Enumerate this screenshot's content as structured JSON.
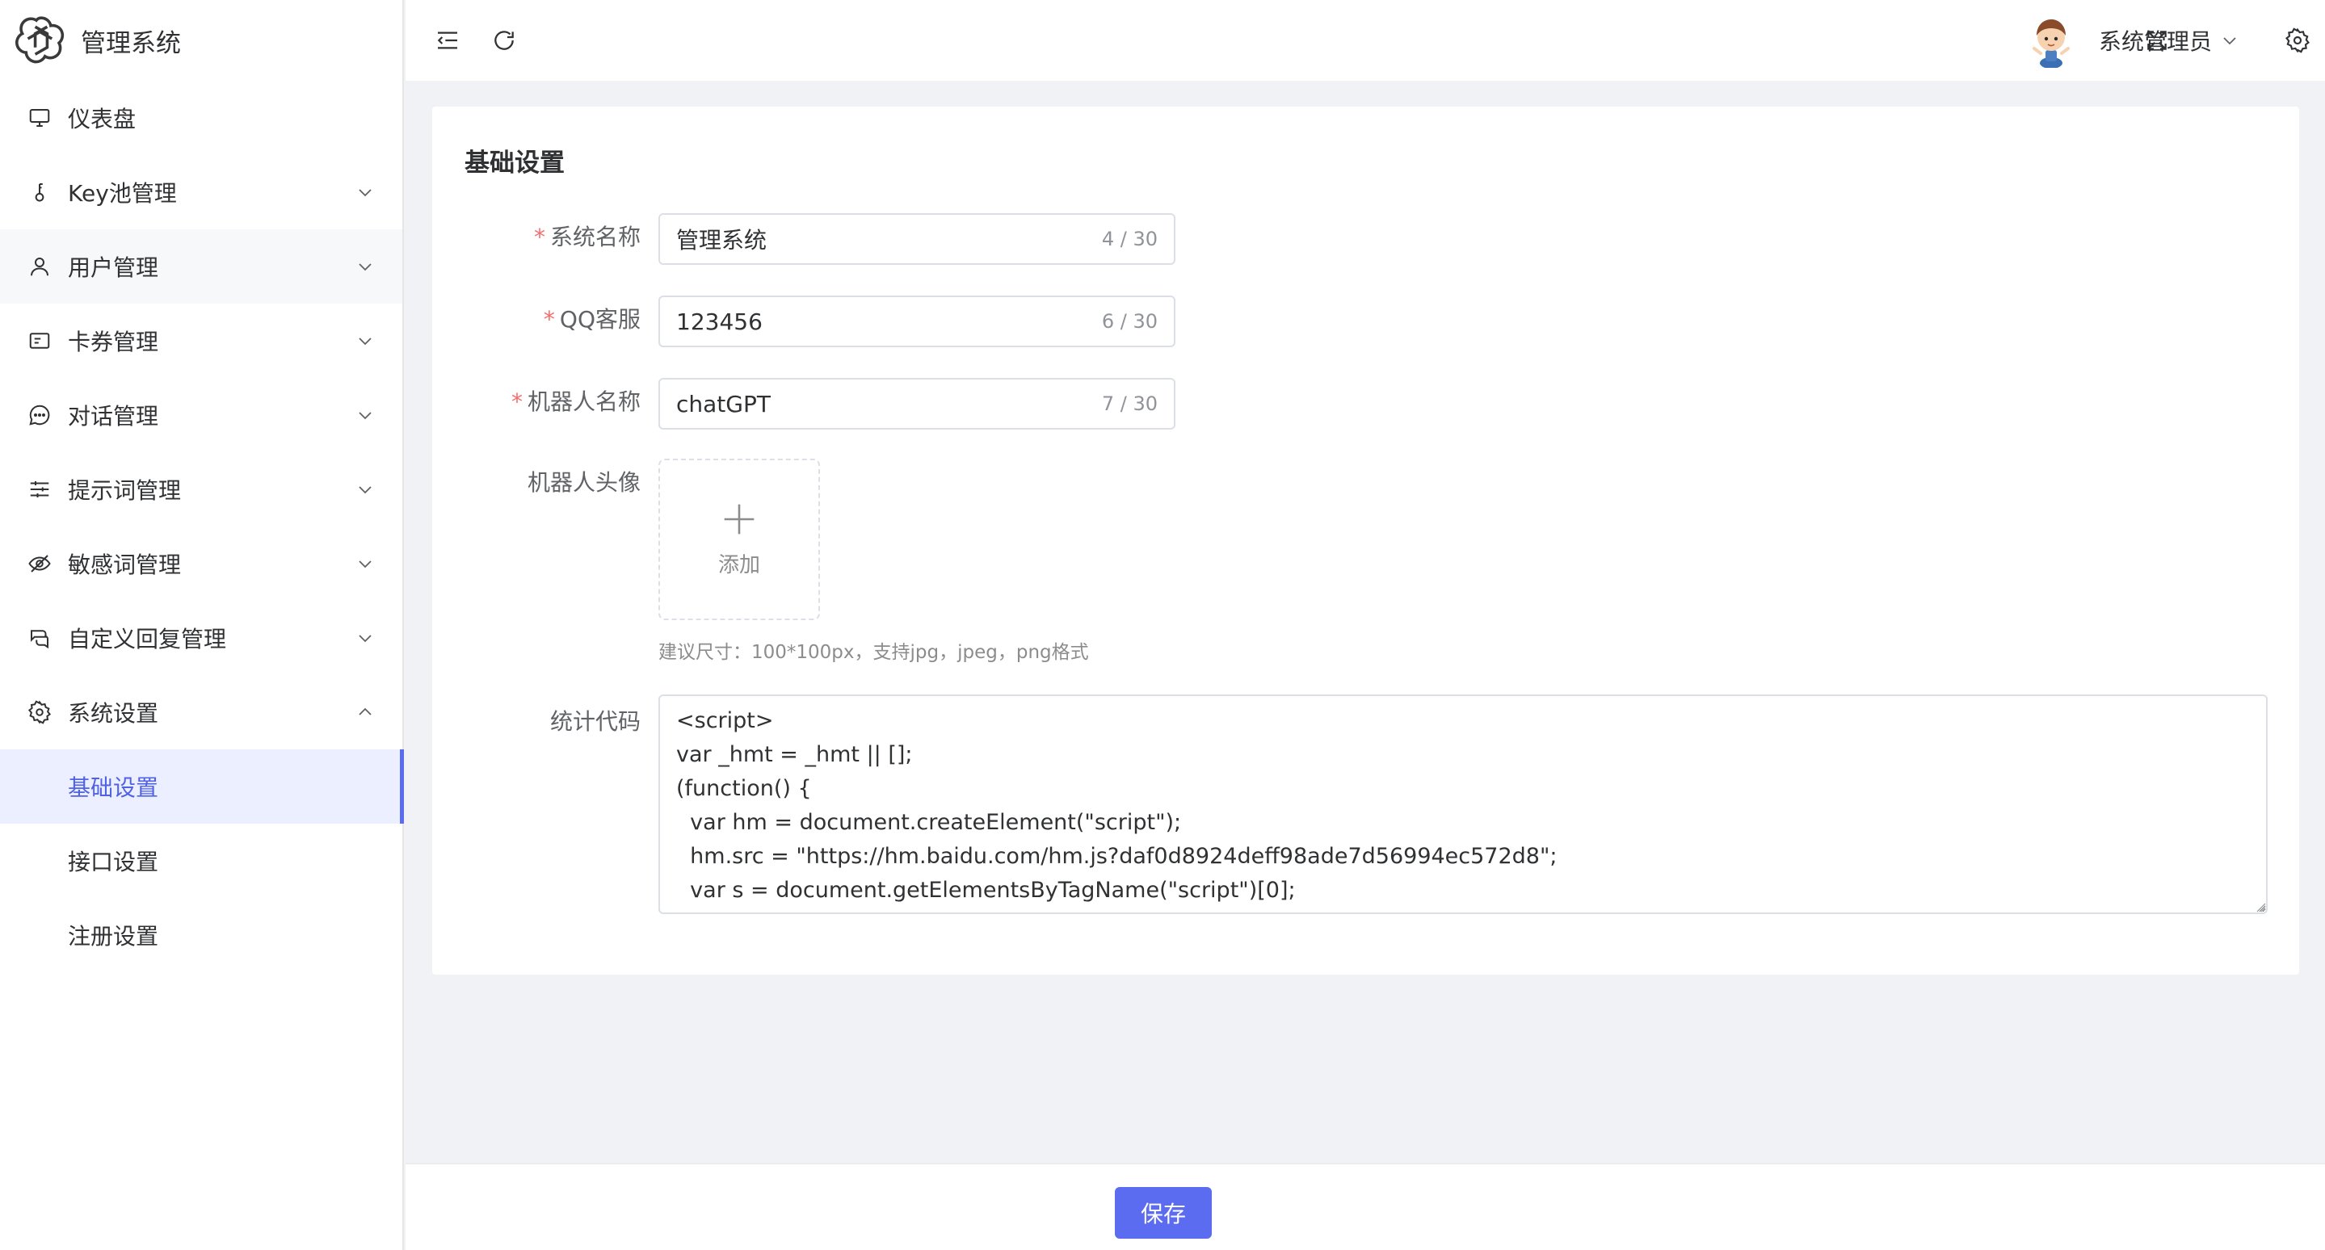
{
  "app": {
    "title": "管理系统",
    "logo_icon": "openai-logo-icon"
  },
  "sidebar": {
    "items": [
      {
        "label": "仪表盘",
        "icon": "monitor-icon",
        "expandable": false
      },
      {
        "label": "Key池管理",
        "icon": "key-icon",
        "expandable": true
      },
      {
        "label": "用户管理",
        "icon": "user-icon",
        "expandable": true
      },
      {
        "label": "卡券管理",
        "icon": "card-icon",
        "expandable": true
      },
      {
        "label": "对话管理",
        "icon": "chat-icon",
        "expandable": true
      },
      {
        "label": "提示词管理",
        "icon": "sliders-icon",
        "expandable": true
      },
      {
        "label": "敏感词管理",
        "icon": "eye-off-icon",
        "expandable": true
      },
      {
        "label": "自定义回复管理",
        "icon": "reply-icon",
        "expandable": true
      },
      {
        "label": "系统设置",
        "icon": "gear-icon",
        "expandable": true,
        "expanded": true
      }
    ],
    "submenu": [
      {
        "label": "基础设置",
        "active": true
      },
      {
        "label": "接口设置",
        "active": false
      },
      {
        "label": "注册设置",
        "active": false
      }
    ],
    "active_color": "#4f62e6"
  },
  "header": {
    "user_name": "系统管理员",
    "icons": [
      "menu-fold-icon",
      "refresh-icon",
      "fullscreen-icon",
      "avatar",
      "settings-icon"
    ]
  },
  "form": {
    "title": "基础设置",
    "fields": {
      "system_name": {
        "label": "系统名称",
        "required": true,
        "value": "管理系统",
        "counter": "4 / 30"
      },
      "qq_service": {
        "label": "QQ客服",
        "required": true,
        "value": "123456",
        "counter": "6 / 30"
      },
      "bot_name": {
        "label": "机器人名称",
        "required": true,
        "value": "chatGPT",
        "counter": "7 / 30"
      },
      "bot_avatar": {
        "label": "机器人头像",
        "upload_text": "添加",
        "hint": "建议尺寸：100*100px，支持jpg，jpeg，png格式"
      },
      "stats_code": {
        "label": "统计代码",
        "value": "<script>\nvar _hmt = _hmt || [];\n(function() {\n  var hm = document.createElement(\"script\");\n  hm.src = \"https://hm.baidu.com/hm.js?daf0d8924deff98ade7d56994ec572d8\";\n  var s = document.getElementsByTagName(\"script\")[0];\n  s.parentNode.insertBefore(hm, s);"
      }
    }
  },
  "footer": {
    "save_label": "保存"
  },
  "colors": {
    "primary": "#5b6cf0",
    "required": "#f56c6c"
  }
}
